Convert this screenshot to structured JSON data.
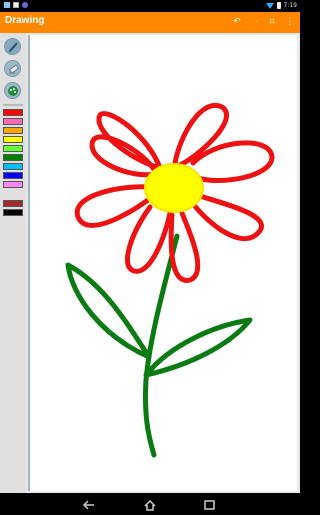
{
  "status_bar": {
    "time": "7:19",
    "notification_icons": [
      "app-notification-icon",
      "photo-notification-icon",
      "circle-notification-icon"
    ]
  },
  "action_bar": {
    "title": "Drawing",
    "actions": [
      {
        "name": "undo-button",
        "icon": "undo-icon",
        "glyph": "↶"
      },
      {
        "name": "overflow-hint",
        "icon": "dots-icon",
        "glyph": "·"
      },
      {
        "name": "clear-button",
        "icon": "clear-icon",
        "glyph": "⌗"
      },
      {
        "name": "menu-button",
        "icon": "overflow-menu-icon",
        "glyph": "⋮"
      }
    ]
  },
  "tools": [
    {
      "name": "pen-tool-button",
      "icon": "pencil-icon",
      "selected": true
    },
    {
      "name": "eraser-tool-button",
      "icon": "eraser-icon",
      "selected": false
    },
    {
      "name": "color-palette-button",
      "icon": "palette-icon",
      "selected": false
    }
  ],
  "palette": {
    "colors": [
      "#ff0000",
      "#ff69b4",
      "#ffa500",
      "#ffff00",
      "#66ff33",
      "#008000",
      "#00bfff",
      "#0000ff",
      "#ff88ff",
      "#a52a2a",
      "#000000"
    ]
  },
  "drawing": {
    "petal_color": "#ff0000",
    "center_color": "#ffff00",
    "stem_color": "#008000"
  },
  "nav_bar": {
    "buttons": [
      {
        "name": "back-button",
        "icon": "back-icon"
      },
      {
        "name": "home-button",
        "icon": "home-icon"
      },
      {
        "name": "recents-button",
        "icon": "recents-icon"
      }
    ]
  }
}
